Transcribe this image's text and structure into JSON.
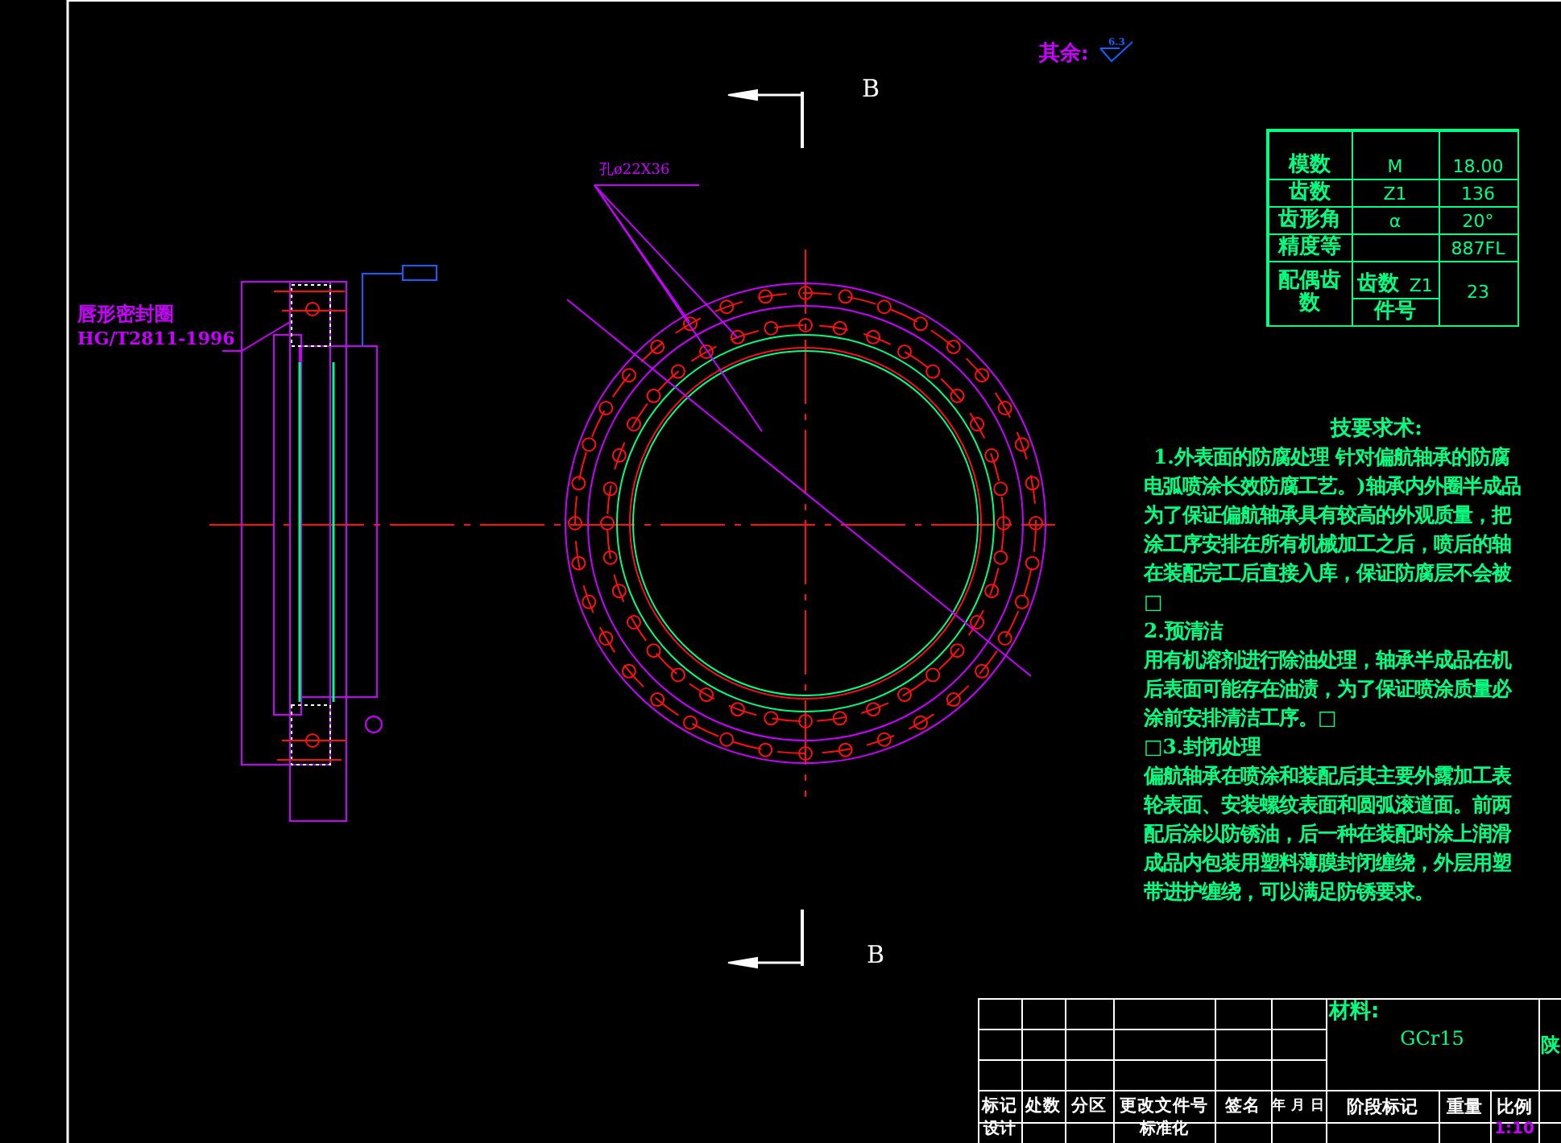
{
  "drawing": {
    "surface_note": {
      "label": "其余:",
      "roughness": "6.3"
    },
    "section_marks": [
      "B",
      "B"
    ],
    "hole_callout": "孔ø22X36",
    "seal_callout": [
      "唇形密封圈",
      "HG/T2811-1996"
    ]
  },
  "gear_table": {
    "rows": [
      {
        "label": "模数",
        "symbol": "M",
        "value": "18.00"
      },
      {
        "label": "齿数",
        "symbol": "Z1",
        "value": "136"
      },
      {
        "label": "齿形角",
        "symbol": "α",
        "value": "20°"
      },
      {
        "label": "精度等",
        "value": "887FL"
      }
    ],
    "mating": {
      "label": "配偶齿数",
      "rows": [
        {
          "label": "齿数",
          "symbol": "Z1"
        },
        {
          "label": "件号"
        }
      ],
      "value": "23"
    }
  },
  "requirements": {
    "title": "技要求术:",
    "lines": [
      "1.外表面的防腐处理 针对偏航轴承的防腐",
      "电弧喷涂长效防腐工艺。)轴承内外圈半成品",
      "为了保证偏航轴承具有较高的外观质量，把",
      "涂工序安排在所有机械加工之后，喷后的轴",
      "在装配完工后直接入库，保证防腐层不会被",
      "□",
      "2.预清洁",
      "用有机溶剂进行除油处理，轴承半成品在机",
      "后表面可能存在油渍，为了保证喷涂质量必",
      "涂前安排清洁工序。□",
      "□3.封闭处理",
      "偏航轴承在喷涂和装配后其主要外露加工表",
      "轮表面、安装螺纹表面和圆弧滚道面。前两",
      "配后涂以防锈油，后一种在装配时涂上润滑",
      "成品内包装用塑料薄膜封闭缠绕，外层用塑",
      "带进护缠绕，可以满足防锈要求。"
    ]
  },
  "title_block": {
    "headers": [
      "标记",
      "处数",
      "分区",
      "更改文件号",
      "签名",
      "年 月 日"
    ],
    "material_label": "材料:",
    "material": "GCr15",
    "company": "陕",
    "stage_headers": [
      "阶段标记",
      "重量",
      "比例"
    ],
    "design_label": "设计",
    "standardization_label": "标准化",
    "scale": "1:10"
  }
}
